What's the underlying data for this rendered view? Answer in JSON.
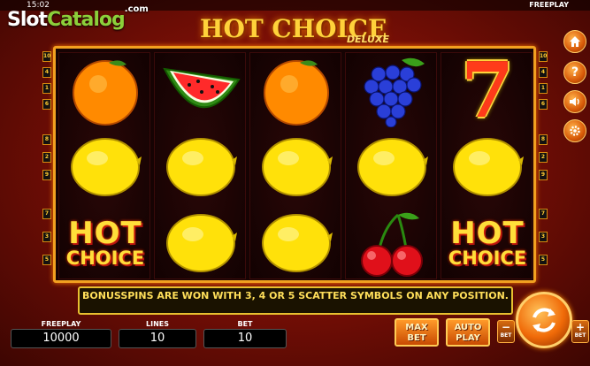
{
  "status_bar": {
    "clock": "15:02",
    "mode": "FREEPLAY"
  },
  "watermark": {
    "part1": "Slot",
    "part2": "Catalog",
    "suffix": ".com"
  },
  "game": {
    "title": "HOT CHOICE",
    "subtitle": "DELUXE"
  },
  "paylines": {
    "left": [
      "10",
      "4",
      "1",
      "6",
      "8",
      "2",
      "9",
      "7",
      "3",
      "5"
    ],
    "right": [
      "10",
      "4",
      "1",
      "6",
      "8",
      "2",
      "9",
      "7",
      "3",
      "5"
    ]
  },
  "reels": [
    [
      "orange-icon",
      "lemon-icon",
      "hot-choice-scatter"
    ],
    [
      "watermelon-icon",
      "lemon-icon",
      "lemon-icon"
    ],
    [
      "orange-icon",
      "lemon-icon",
      "lemon-icon"
    ],
    [
      "grapes-icon",
      "lemon-icon",
      "cherries-icon"
    ],
    [
      "seven-icon",
      "lemon-icon",
      "hot-choice-scatter"
    ]
  ],
  "scatter_text": {
    "line1": "HOT",
    "line2": "CHOICE"
  },
  "seven_glyph": "7",
  "message": "BONUSSPINS ARE WON WITH 3, 4 OR 5 SCATTER SYMBOLS ON ANY POSITION.",
  "panel": {
    "freeplay_label": "FREEPLAY",
    "freeplay_value": "10000",
    "lines_label": "LINES",
    "lines_value": "10",
    "bet_label": "BET",
    "bet_value": "10"
  },
  "buttons": {
    "max_bet_line1": "MAX",
    "max_bet_line2": "BET",
    "auto_play_line1": "AUTO",
    "auto_play_line2": "PLAY",
    "bet_minus_symbol": "−",
    "bet_minus_label": "BET",
    "bet_plus_symbol": "+",
    "bet_plus_label": "BET"
  },
  "side_menu": [
    "home-icon",
    "help-icon",
    "sound-icon",
    "settings-icon"
  ],
  "colors": {
    "accent": "#f2a020",
    "background": "#7a0f06",
    "text_yellow": "#ffdf5a"
  }
}
